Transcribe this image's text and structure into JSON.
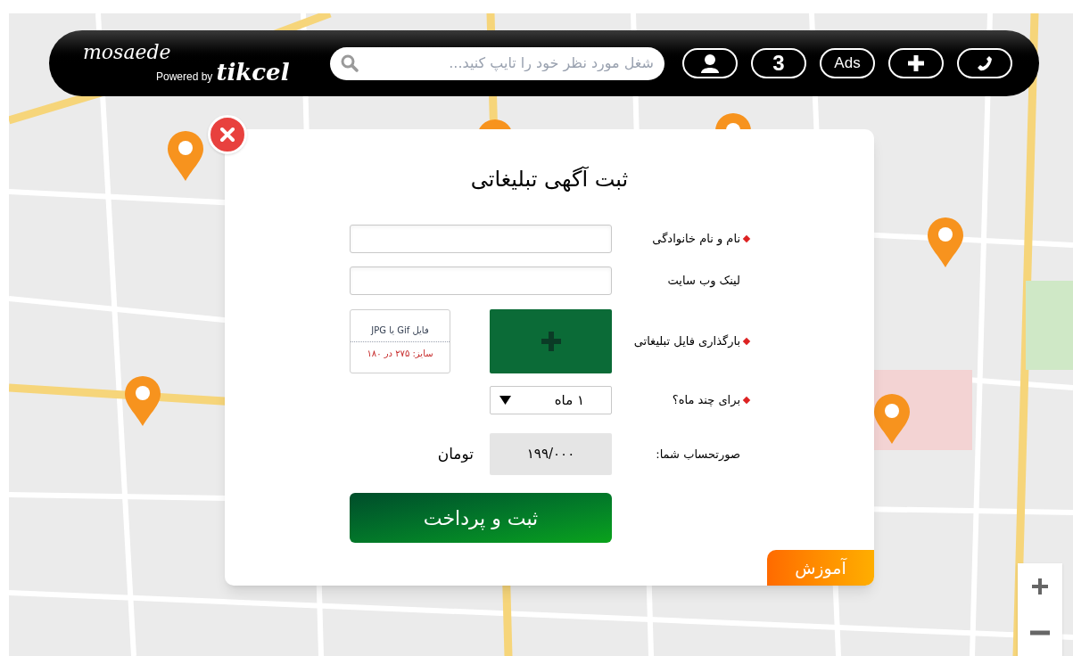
{
  "header": {
    "logo": {
      "name": "mosaede",
      "powered_by": "Powered by",
      "brand": "tikcel"
    },
    "search": {
      "placeholder": "شغل مورد نظر خود را تایپ کنید..."
    },
    "buttons": [
      {
        "kind": "phone"
      },
      {
        "kind": "add"
      },
      {
        "kind": "text",
        "label": "Ads"
      },
      {
        "kind": "text",
        "label": "3"
      },
      {
        "kind": "user"
      }
    ]
  },
  "dialog": {
    "title": "ثبت آگهی تبلیغاتی",
    "fields": [
      {
        "kind": "text",
        "label": "نام و نام خانوادگی",
        "required": true
      },
      {
        "kind": "text",
        "label": "لینک وب سایت",
        "required": false
      },
      {
        "kind": "upload",
        "label": "بارگذاری فایل تبلیغاتی",
        "required": true,
        "hint": "فایل Gif یا JPG",
        "size_note": "سایز: ۲۷۵ در ۱۸۰"
      },
      {
        "kind": "select",
        "label": "برای چند ماه؟",
        "required": true,
        "value": "۱ ماه"
      },
      {
        "kind": "price",
        "label": "صورتحساب شما:",
        "required": false,
        "value": "۱۹۹/۰۰۰",
        "unit": "تومان"
      }
    ],
    "submit": "ثبت و پرداخت",
    "help_tab": "آموزش"
  }
}
